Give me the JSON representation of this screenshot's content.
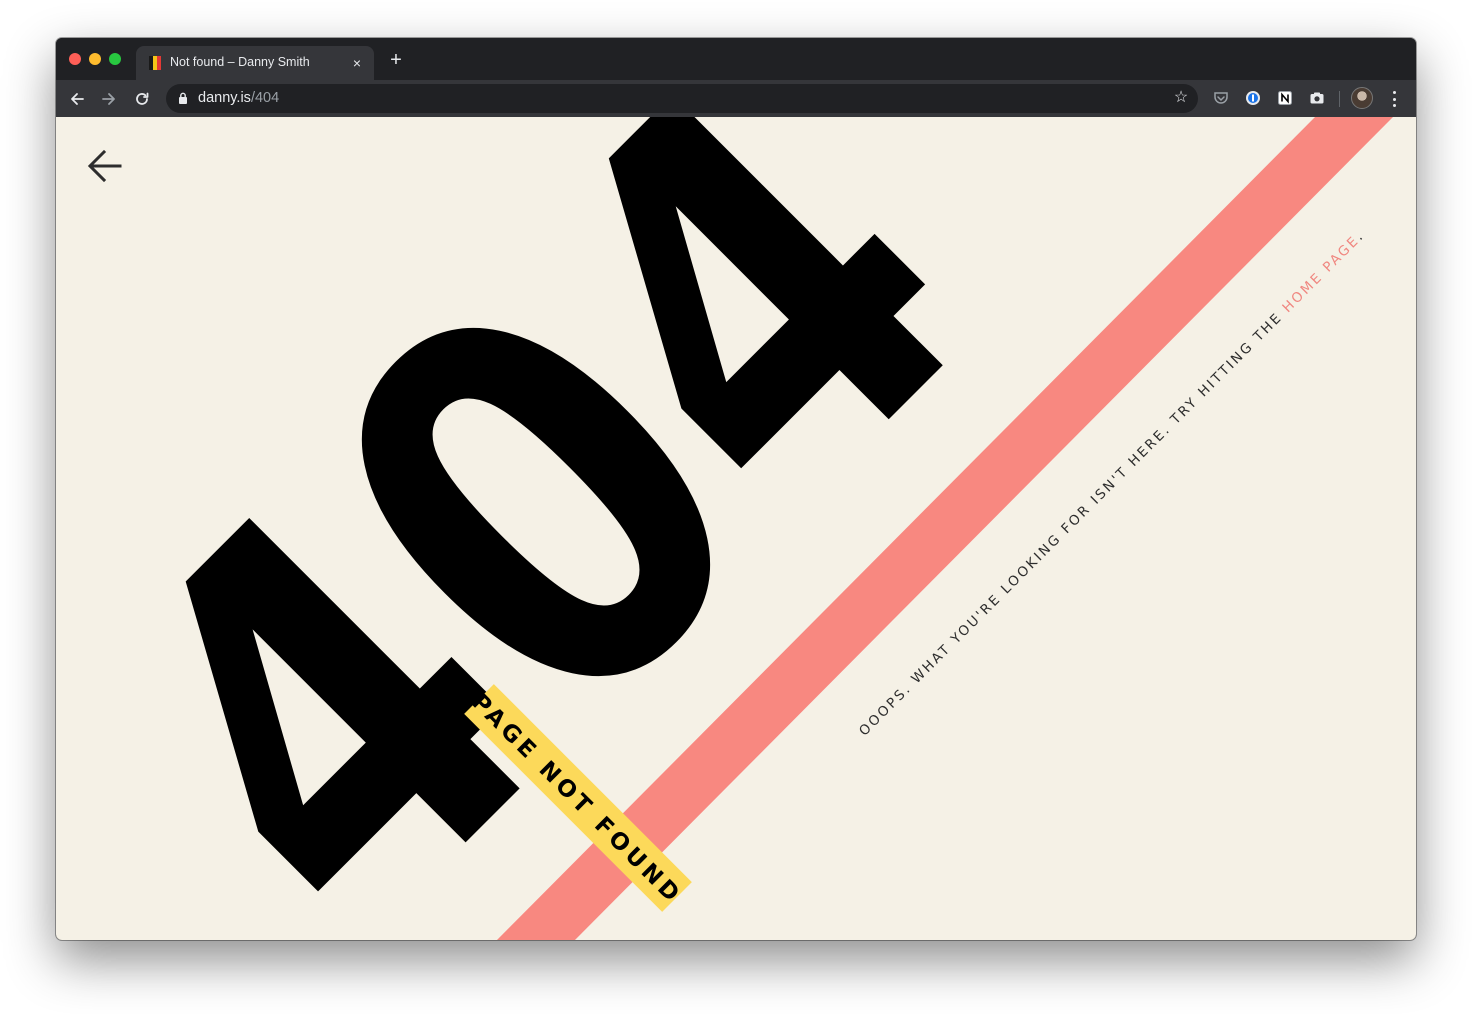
{
  "browser": {
    "tab": {
      "title": "Not found – Danny Smith"
    },
    "new_tab_label": "+",
    "close_tab_label": "×",
    "address": {
      "host": "danny.is",
      "path": "/404"
    }
  },
  "page": {
    "big_number": "404",
    "ribbon_label": "PAGE NOT FOUND",
    "message": "OOOPS. WHAT YOU'RE LOOKING FOR ISN'T HERE. TRY HITTING THE ",
    "home_link_label": "HOME PAGE",
    "message_end": "."
  },
  "colors": {
    "page_background": "#f5f1e6",
    "stripe": "#f88880",
    "ribbon": "#fcd95a",
    "digits": "#000000",
    "link": "#f08780",
    "favicon_stripes": [
      "#1a1a1a",
      "#f5c518",
      "#e53935"
    ]
  },
  "icons": {
    "back": "arrow-left-icon",
    "forward": "arrow-right-icon",
    "reload": "reload-icon",
    "lock": "lock-icon",
    "bookmark": "star-icon",
    "extensions": [
      "pocket-icon",
      "password-manager-icon",
      "notion-icon",
      "screenshot-camera-icon"
    ],
    "menu": "more-vertical-icon"
  }
}
